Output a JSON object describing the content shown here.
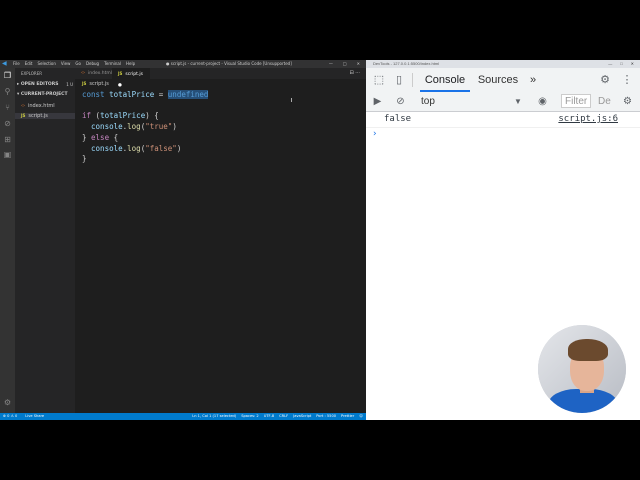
{
  "vscode": {
    "menu": [
      "File",
      "Edit",
      "Selection",
      "View",
      "Go",
      "Debug",
      "Terminal",
      "Help"
    ],
    "window_title": "● script.js - current-project - Visual Studio Code [Unsupported]",
    "explorer_title": "EXPLORER",
    "open_editors_label": "OPEN EDITORS",
    "open_editors_badge": "1 U",
    "project_label": "CURRENT-PROJECT",
    "files": [
      "index.html",
      "script.js"
    ],
    "tabs": [
      {
        "label": "index.html"
      },
      {
        "label": "script.js"
      }
    ],
    "breadcrumb": "script.js",
    "code": {
      "line1": {
        "kw": "const",
        "var": "totalPrice",
        "op": " = ",
        "val": "undefined"
      },
      "line3": {
        "kw": "if",
        "open": " (",
        "var": "totalPrice",
        "close": ") {"
      },
      "line4": {
        "obj": "console",
        "dot": ".",
        "fn": "log",
        "open": "(",
        "str": "\"true\"",
        "close": ")"
      },
      "line5": {
        "text1": "} ",
        "kw": "else",
        "text2": " {"
      },
      "line6": {
        "obj": "console",
        "dot": ".",
        "fn": "log",
        "open": "(",
        "str": "\"false\"",
        "close": ")"
      },
      "line7": "}"
    },
    "status_left": [
      "⊗ 0 ⚠ 0",
      "Live Share"
    ],
    "status_right": [
      "Ln 1, Col 1 (17 selected)",
      "Spaces: 2",
      "UTF-8",
      "CRLF",
      "JavaScript",
      "Port : 5500",
      "Prettier",
      "☺"
    ]
  },
  "devtools": {
    "window_title": "DevTools - 127.0.0.1:5500/index.html",
    "tabs": [
      "Console",
      "Sources"
    ],
    "more": "»",
    "context": "top",
    "filter_placeholder": "Filter",
    "levels": "De",
    "log": {
      "message": "false",
      "source": "script.js:6"
    },
    "prompt": "›"
  },
  "colors": {
    "accent": "#1a73e8",
    "vscode_status": "#007acc"
  }
}
